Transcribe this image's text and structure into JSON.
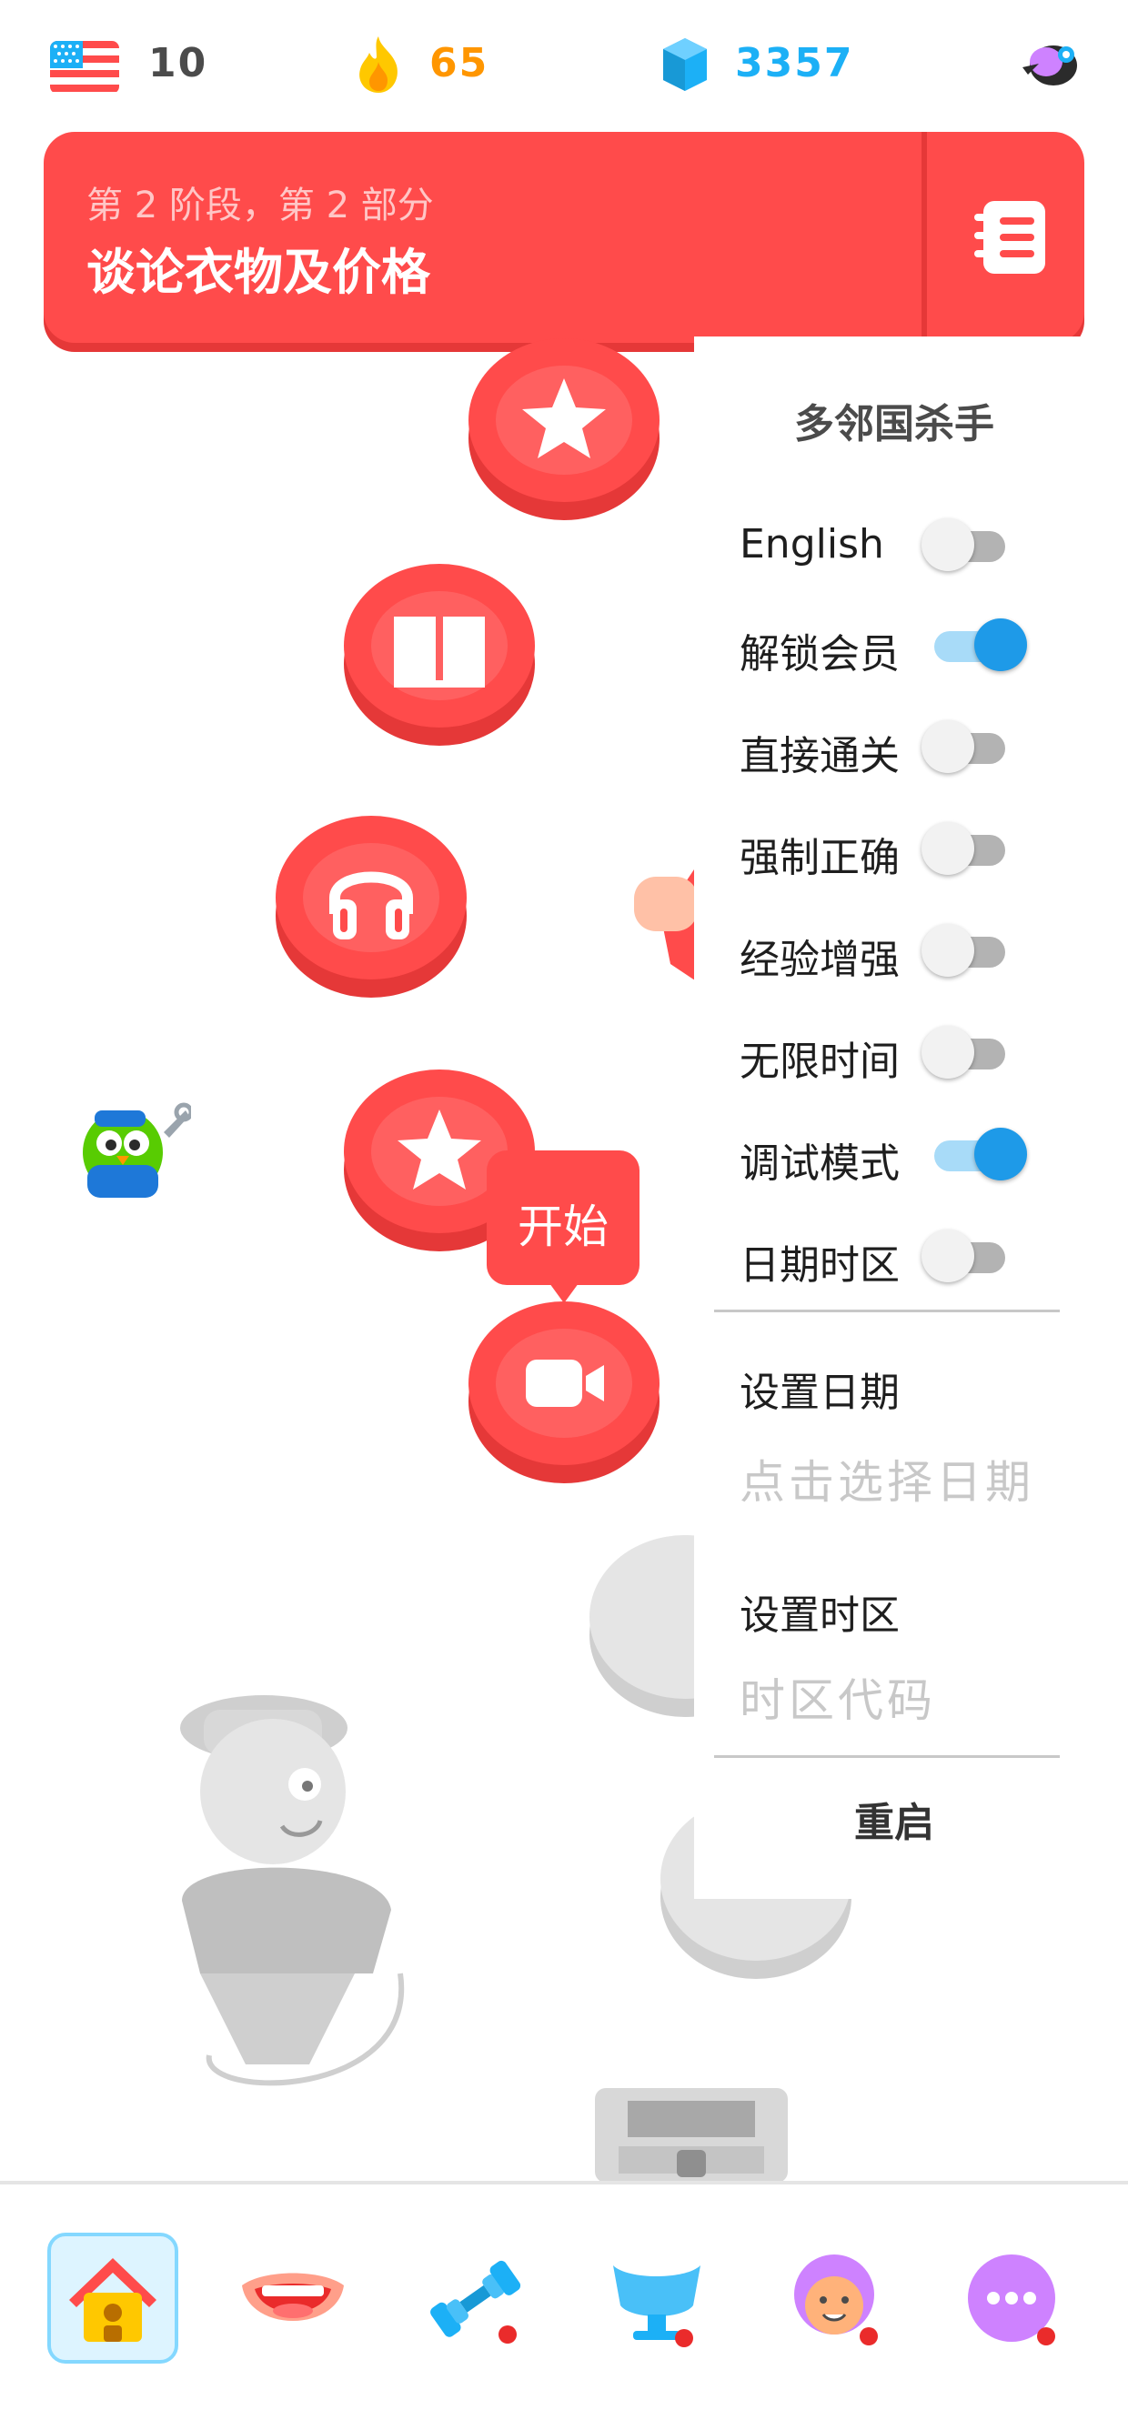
{
  "stats": {
    "streak_count": "10",
    "gems_count": "65",
    "xp_count": "3357"
  },
  "unit": {
    "subtitle": "第 2 阶段，第 2 部分",
    "title": "谈论衣物及价格"
  },
  "path": {
    "start_label": "开始"
  },
  "panel": {
    "title": "多邻国杀手",
    "options": [
      {
        "label": "English",
        "on": false
      },
      {
        "label": "解锁会员",
        "on": true
      },
      {
        "label": "直接通关",
        "on": false
      },
      {
        "label": "强制正确",
        "on": false
      },
      {
        "label": "经验增强",
        "on": false
      },
      {
        "label": "无限时间",
        "on": false
      },
      {
        "label": "调试模式",
        "on": true
      },
      {
        "label": "日期时区",
        "on": false
      }
    ],
    "date_label": "设置日期",
    "date_placeholder": "点击选择日期",
    "timezone_label": "设置时区",
    "timezone_placeholder": "时区代码",
    "restart_label": "重启"
  },
  "colors": {
    "primary_red": "#ff4b4b",
    "toggle_on": "#1e9ae8",
    "streak_gray": "#4b4b4b",
    "gems_orange": "#ff9600",
    "xp_blue": "#1cb0f6"
  },
  "icons": {
    "top": [
      "us-flag-icon",
      "flame-icon",
      "gem-icon",
      "profile-icon"
    ],
    "nav": [
      "home-icon",
      "speaking-mouth-icon",
      "practice-dumbbell-icon",
      "leagues-trophy-icon",
      "characters-avatar-icon",
      "more-icon"
    ]
  }
}
